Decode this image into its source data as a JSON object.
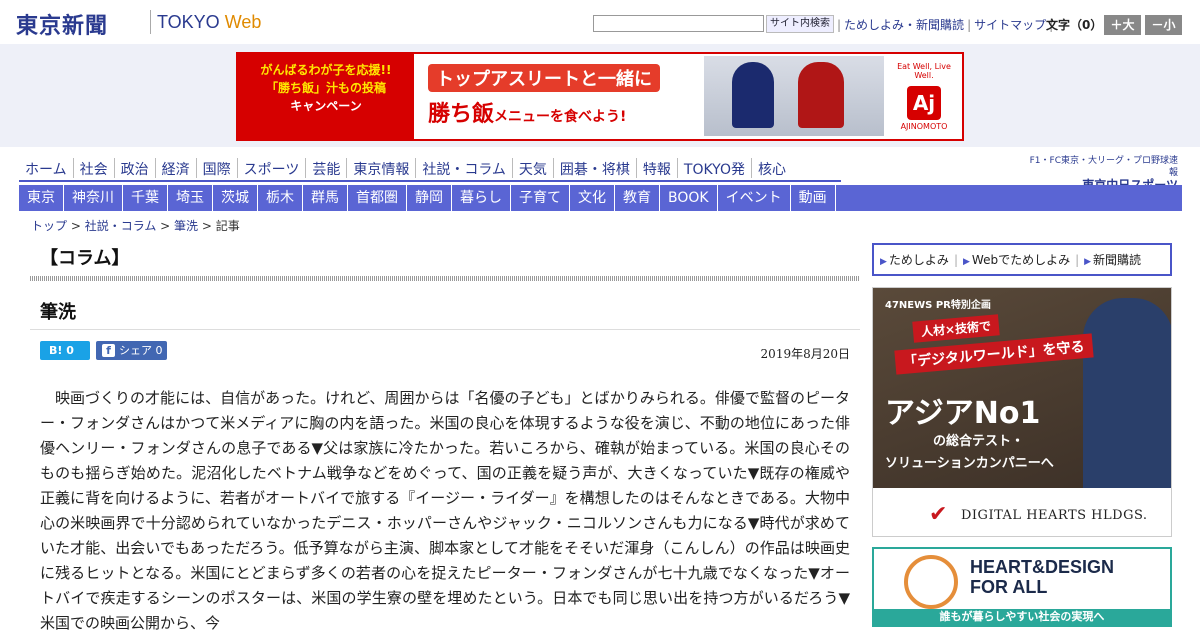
{
  "header": {
    "logo_jp": "東京新聞",
    "logo_en_1": "TOKYO",
    "logo_en_2": "Web",
    "search_placeholder": "",
    "search_button": "サイト内検索",
    "links": [
      "ためしよみ・新聞購読",
      "サイトマップ"
    ],
    "font_size_label": "文字（0）",
    "font_bigger": "＋大",
    "font_smaller": "－小"
  },
  "banner_ad": {
    "left_line1": "がんばるわが子を応援!!",
    "left_line2": "「勝ち飯」汁もの投稿",
    "left_line3": "キャンペーン",
    "title": "トップアスリートと一緒に",
    "sub_main": "勝ち飯",
    "sub_rest": "メニューを食べよう!",
    "brand_tagline": "Eat Well, Live Well.",
    "brand_mark": "Aj",
    "brand_name": "AJINOMOTO"
  },
  "nav_primary": [
    "ホーム",
    "社会",
    "政治",
    "経済",
    "国際",
    "スポーツ",
    "芸能",
    "東京情報",
    "社説・コラム",
    "天気",
    "囲碁・将棋",
    "特報",
    "TOKYO発",
    "核心"
  ],
  "chunichi": {
    "line1": "F1・FC東京・大リーグ・プロ野球速報",
    "line2": "東京中日スポーツ"
  },
  "nav_secondary": [
    "東京",
    "神奈川",
    "千葉",
    "埼玉",
    "茨城",
    "栃木",
    "群馬",
    "首都圏",
    "静岡",
    "暮らし",
    "子育て",
    "文化",
    "教育",
    "BOOK",
    "イベント",
    "動画"
  ],
  "breadcrumb": {
    "top": "トップ",
    "section": "社説・コラム",
    "sub": "筆洗",
    "current": "記事"
  },
  "article": {
    "category": "【コラム】",
    "title": "筆洗",
    "hatena_label": "B! 0",
    "fb_label": "シェア 0",
    "fb_icon": "f",
    "date": "2019年8月20日",
    "body": "映画づくりの才能には、自信があった。けれど、周囲からは「名優の子ども」とばかりみられる。俳優で監督のピーター・フォンダさんはかつて米メディアに胸の内を語った。米国の良心を体現するような役を演じ、不動の地位にあった俳優ヘンリー・フォンダさんの息子である▼父は家族に冷たかった。若いころから、確執が始まっている。米国の良心そのものも揺らぎ始めた。泥沼化したベトナム戦争などをめぐって、国の正義を疑う声が、大きくなっていた▼既存の権威や正義に背を向けるように、若者がオートバイで旅する『イージー・ライダー』を構想したのはそんなときである。大物中心の米映画界で十分認められていなかったデニス・ホッパーさんやジャック・ニコルソンさんも力になる▼時代が求めていた才能、出会いでもあっただろう。低予算ながら主演、脚本家として才能をそそいだ渾身（こんしん）の作品は映画史に残るヒットとなる。米国にとどまらず多くの若者の心を捉えたピーター・フォンダさんが七十九歳でなくなった▼オートバイで疾走するシーンのポスターは、米国の学生寮の壁を埋めたという。日本でも同じ思い出を持つ方がいるだろう▼米国での映画公開から、今"
  },
  "sidebar": {
    "links": [
      "ためしよみ",
      "Webでためしよみ",
      "新聞購読"
    ],
    "ad2": {
      "label": "47NEWS PR特別企画",
      "red1": "人材×技術で",
      "red2": "「デジタルワールド」を守る",
      "asia": "アジアNo1",
      "sub1": "の総合テスト・",
      "sub2": "ソリューションカンパニーへ",
      "brand": "DIGITAL HEARTS HLDGS."
    },
    "ad3": {
      "title_line1": "HEART&DESIGN",
      "title_line2": "FOR ALL",
      "bar": "誰もが暮らしやすい社会の実現へ"
    }
  }
}
